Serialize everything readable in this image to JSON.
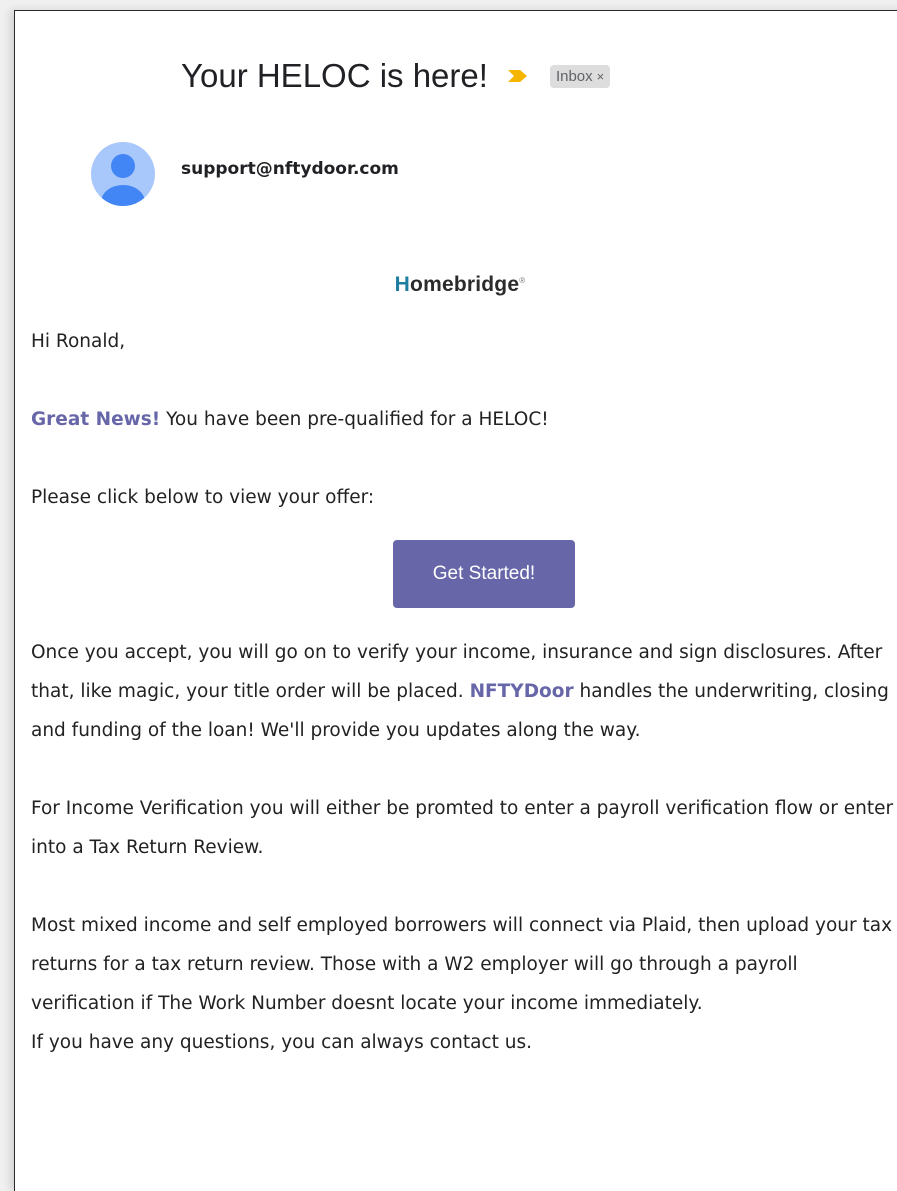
{
  "email": {
    "subject": "Your HELOC is here!",
    "label": "Inbox",
    "label_close": "×",
    "sender": "support@nftydoor.com"
  },
  "logo": {
    "text": "omebridge",
    "mark": "H",
    "reg": "®"
  },
  "body": {
    "greeting": "Hi Ronald,",
    "news_bold": "Great News!",
    "news_rest": " You have been pre-qualified for a HELOC!",
    "click_prompt": "Please click below to view your offer:",
    "button_label": "Get Started!",
    "para1_a": "Once you accept, you will go on to verify your income, insurance and sign disclosures. After that, like magic, your title order will be placed. ",
    "para1_brand": "NFTYDoor",
    "para1_b": " handles the underwriting, closing and funding of the loan! We'll provide you updates along the way.",
    "para2": "For Income Verification you will either be promted to enter a payroll verification flow or enter into a Tax Return Review.",
    "para3": "Most mixed income and self employed borrowers will connect via Plaid, then upload your tax returns for a tax return review. Those with a W2 employer will go through a payroll verification if The Work Number doesnt locate your income immediately.",
    "para4": "If you have any questions, you can always contact us."
  },
  "colors": {
    "accent": "#6766a8",
    "important_marker": "#f4b400",
    "avatar_bg": "#a8c7fa",
    "avatar_fg": "#4285f4"
  }
}
